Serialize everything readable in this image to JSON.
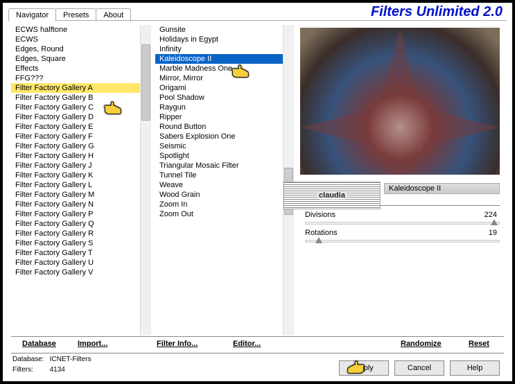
{
  "app_title": "Filters Unlimited 2.0",
  "tabs": {
    "navigator": "Navigator",
    "presets": "Presets",
    "about": "About"
  },
  "categories": [
    "ECWS halftone",
    "ECWS",
    "Edges, Round",
    "Edges, Square",
    "Effects",
    "FFG???",
    "Filter Factory Gallery A",
    "Filter Factory Gallery B",
    "Filter Factory Gallery C",
    "Filter Factory Gallery D",
    "Filter Factory Gallery E",
    "Filter Factory Gallery F",
    "Filter Factory Gallery G",
    "Filter Factory Gallery H",
    "Filter Factory Gallery J",
    "Filter Factory Gallery K",
    "Filter Factory Gallery L",
    "Filter Factory Gallery M",
    "Filter Factory Gallery N",
    "Filter Factory Gallery P",
    "Filter Factory Gallery Q",
    "Filter Factory Gallery R",
    "Filter Factory Gallery S",
    "Filter Factory Gallery T",
    "Filter Factory Gallery U",
    "Filter Factory Gallery V"
  ],
  "category_selected_index": 6,
  "filters": [
    "Gunsite",
    "Holidays in Egypt",
    "Infinity",
    "Kaleidoscope II",
    "Marble Madness One",
    "Mirror, Mirror",
    "Origami",
    "Pool Shadow",
    "Raygun",
    "Ripper",
    "Round Button",
    "Sabers Explosion One",
    "Seismic",
    "Spotlight",
    "Triangular Mosaic Filter",
    "Tunnel Tile",
    "Weave",
    "Wood Grain",
    "Zoom In",
    "Zoom Out"
  ],
  "filter_selected_index": 3,
  "watermark_text": "claudia",
  "current_filter_name": "Kaleidoscope II",
  "params": {
    "divisions": {
      "label": "Divisions",
      "value": "224"
    },
    "rotations": {
      "label": "Rotations",
      "value": "19"
    }
  },
  "toolbar": {
    "database": "Database",
    "import": "Import...",
    "filterinfo": "Filter Info...",
    "editor": "Editor...",
    "randomize": "Randomize",
    "reset": "Reset"
  },
  "buttons": {
    "apply": "Apply",
    "cancel": "Cancel",
    "help": "Help"
  },
  "status": {
    "db_label": "Database:",
    "db_value": "ICNET-Filters",
    "filters_label": "Filters:",
    "filters_value": "4134"
  }
}
